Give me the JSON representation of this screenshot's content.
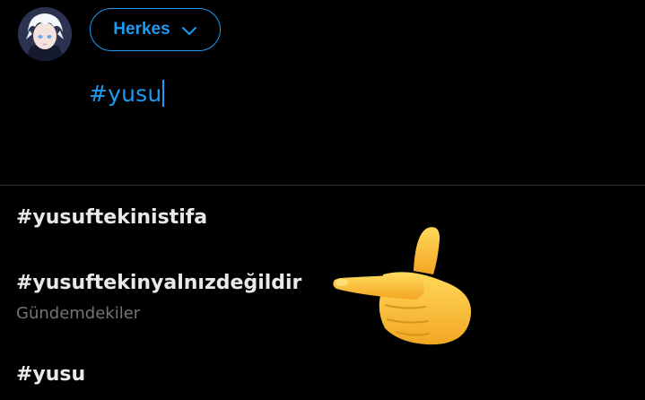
{
  "composer": {
    "audience_label": "Herkes",
    "audience_chevron_icon": "chevron-down-icon",
    "text": "#yusu",
    "accent_color": "#1d9bf0"
  },
  "suggestions": [
    {
      "label": "#yusuftekinistifa"
    },
    {
      "label": "#yusuftekinyalnızdeğildir",
      "subtitle": "Gündemdekiler"
    },
    {
      "label": "#yusu"
    }
  ],
  "overlay": {
    "emoji_icon": "pointing-left-hand-emoji"
  }
}
